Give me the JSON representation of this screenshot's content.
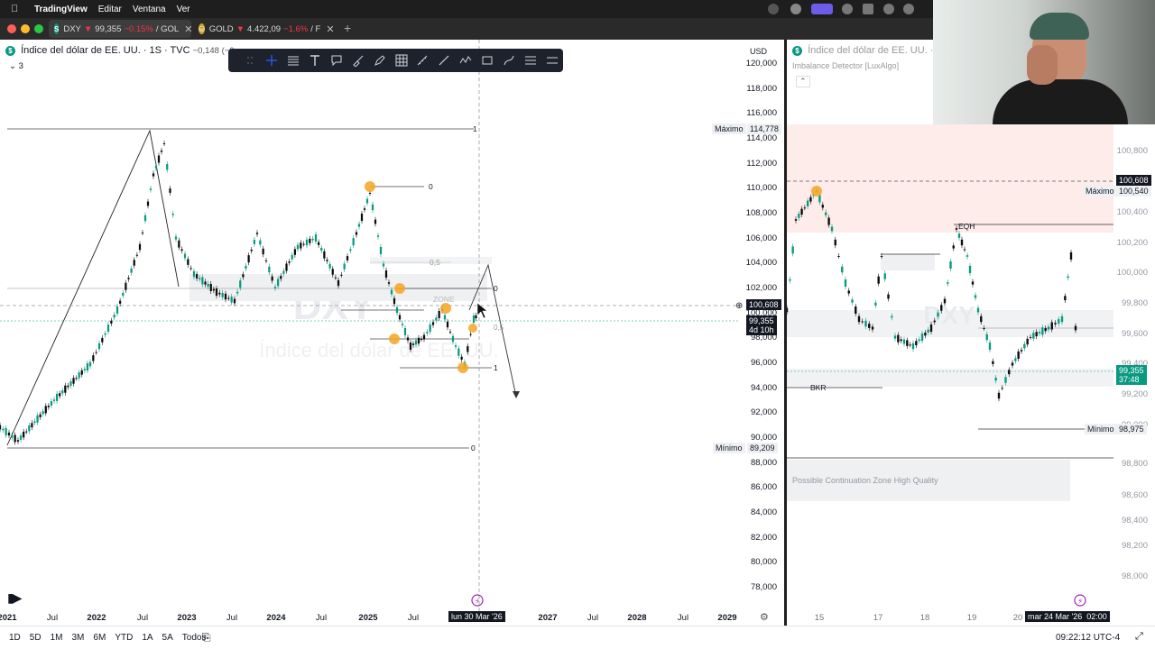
{
  "menubar": {
    "app_name": "TradingView",
    "items": [
      "Editar",
      "Ventana",
      "Ver"
    ]
  },
  "tabs": [
    {
      "symbol_letter": "S",
      "symbol_color": "#089981",
      "name": "DXY",
      "arrow": "▼",
      "price": "99,355",
      "change": "−0.15%",
      "tail": "/ GOL"
    },
    {
      "symbol_letter": "⛁",
      "symbol_color": "#c9a227",
      "name": "GOLD",
      "arrow": "▼",
      "price": "4.422,09",
      "change": "−1.6%",
      "tail": "/ F"
    }
  ],
  "left_chart": {
    "legend_title": "Índice del dólar de EE. UU. · 1S · TVC",
    "legend_change": "−0,148 (−0,",
    "legend_count": "3",
    "currency": "USD",
    "watermark_symbol": "DXY",
    "watermark_name": "Índice del dólar de EE. UU.",
    "y_ticks": [
      "120,000",
      "118,000",
      "116,000",
      "114,000",
      "112,000",
      "110,000",
      "108,000",
      "106,000",
      "104,000",
      "102,000",
      "100,000",
      "98,000",
      "96,000",
      "94,000",
      "92,000",
      "90,000",
      "88,000",
      "86,000",
      "84,000",
      "82,000",
      "80,000",
      "78,000"
    ],
    "max_label": "Máximo",
    "max_value": "114,778",
    "min_label": "Mínimo",
    "min_value": "89,209",
    "crosshair_price": "100,608",
    "last_price": "99,355",
    "countdown": "4d 10h",
    "x_ticks": [
      "2021",
      "Jul",
      "2022",
      "Jul",
      "2023",
      "Jul",
      "2024",
      "Jul",
      "2025",
      "Jul",
      "2027",
      "Jul",
      "2028",
      "Jul",
      "2029"
    ],
    "x_cursor_label": "lun 30 Mar '26",
    "fib_labels": [
      "1",
      "0",
      "0",
      "0,5",
      "0",
      "1",
      "0,5"
    ],
    "zone_label": "ZONE"
  },
  "right_chart": {
    "legend_title": "Índice del dólar de EE. UU. · 1",
    "indicator": "Imbalance Detector [LuxAlgo]",
    "y_ticks": [
      "100,800",
      "100,400",
      "100,200",
      "100,000",
      "99,800",
      "99,600",
      "99,400",
      "99,200",
      "99,000",
      "98,800",
      "98,600",
      "98,400",
      "98,200",
      "98,000"
    ],
    "crosshair_price": "100,608",
    "max_label": "Máximo",
    "max_value": "100,540",
    "last_price": "99,355",
    "countdown": "37:48",
    "min_label": "Mínimo",
    "min_value": "98,975",
    "eqh_label": "EQH",
    "bkr_label": "BKR",
    "continuation_zone": "Possible Continuation Zone High Quality",
    "x_ticks": [
      "15",
      "17",
      "18",
      "19",
      "20"
    ],
    "x_cursor_label": "mar 24 Mar '26",
    "x_cursor_time": "02:00"
  },
  "bottombar": {
    "timeframes": [
      "1D",
      "5D",
      "1M",
      "3M",
      "6M",
      "YTD",
      "1A",
      "5A",
      "Todos"
    ],
    "clock": "09:22:12 UTC-4"
  },
  "colors": {
    "up": "#089981",
    "down": "#f23645",
    "marker": "#f5a623",
    "premium_zone": "#fde7e3"
  }
}
